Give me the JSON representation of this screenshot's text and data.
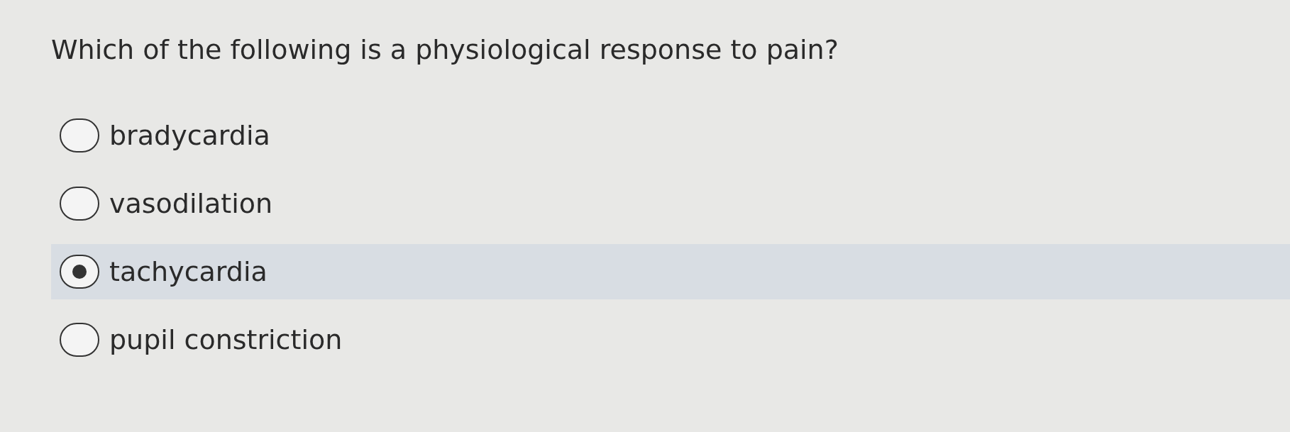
{
  "question": "Which of the following is a physiological response to pain?",
  "options": [
    {
      "label": "bradycardia",
      "selected": false
    },
    {
      "label": "vasodilation",
      "selected": false
    },
    {
      "label": "tachycardia",
      "selected": true
    },
    {
      "label": "pupil constriction",
      "selected": false
    }
  ]
}
